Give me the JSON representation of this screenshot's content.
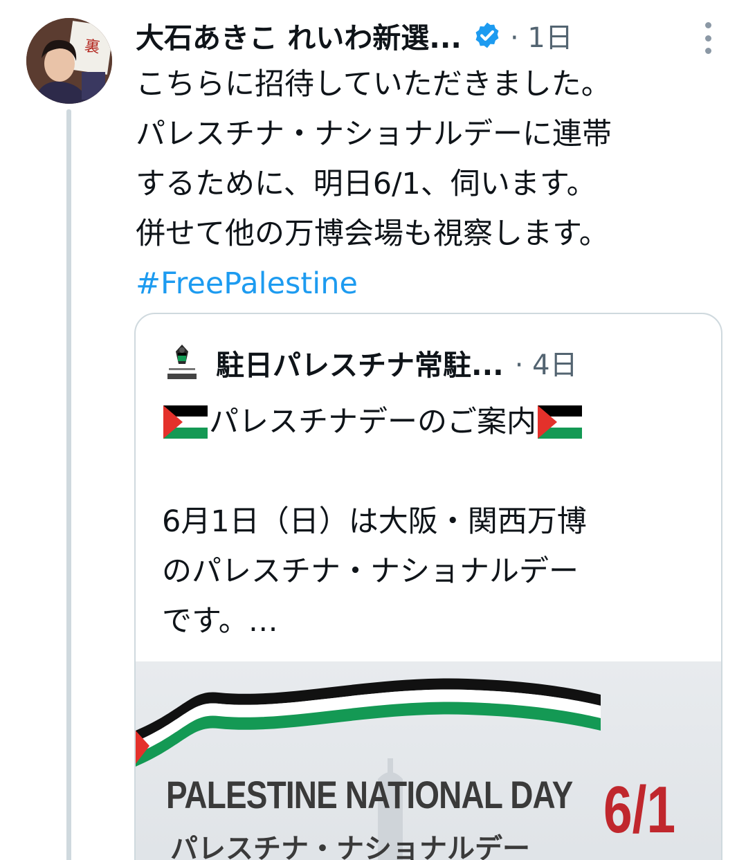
{
  "tweet": {
    "author_name": "大石あきこ れいわ新選...",
    "meta": "· 1日",
    "body_lines": [
      "こちらに招待していただきました。",
      "パレスチナ・ナショナルデーに連帯",
      "するために、明日6/1、伺います。",
      "併せて他の万博会場も視察します。"
    ],
    "hashtag": "#FreePalestine"
  },
  "quote": {
    "author_name": "駐日パレスチナ常駐...",
    "meta": "· 4日",
    "headline": "パレスチナデーのご案内",
    "body_lines": [
      "6月1日（日）は大阪・関西万博",
      "のパレスチナ・ナショナルデー",
      "です。…"
    ],
    "image": {
      "title": "PALESTINE NATIONAL DAY",
      "subtitle": "パレスチナ・ナショナルデー",
      "date": "6/1"
    }
  },
  "colors": {
    "link": "#1d9bf0",
    "verified": "#1d9bf0",
    "muted": "#536471",
    "flag_black": "#000000",
    "flag_white": "#ffffff",
    "flag_green": "#149954",
    "flag_red": "#e4312b",
    "date_red": "#c0272d"
  },
  "icons": [
    "verified-badge-icon",
    "more-options-icon",
    "palestine-flag-icon"
  ]
}
